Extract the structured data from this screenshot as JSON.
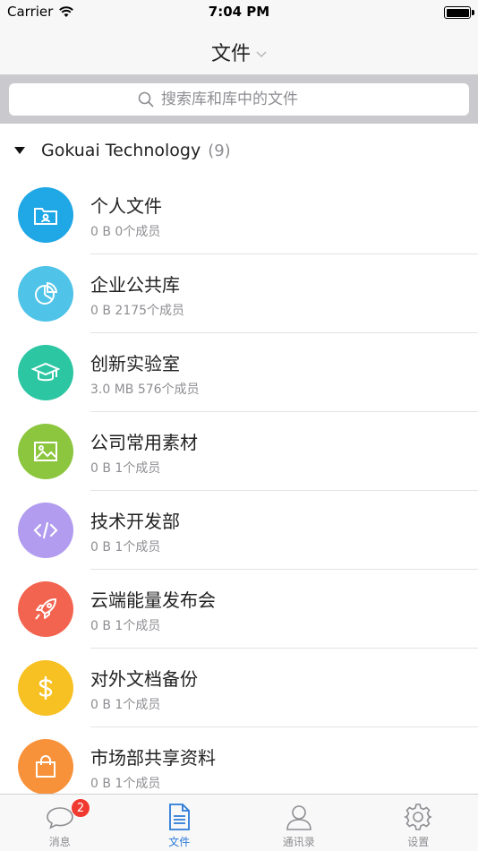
{
  "status": {
    "carrier": "Carrier",
    "time": "7:04 PM"
  },
  "nav": {
    "title": "文件"
  },
  "search": {
    "placeholder": "搜索库和库中的文件"
  },
  "group": {
    "name": "Gokuai Technology",
    "count": "(9)"
  },
  "items": [
    {
      "title": "个人文件",
      "sub": "0 B 0个成员",
      "color": "#1fa7e6",
      "icon": "user-folder-icon"
    },
    {
      "title": "企业公共库",
      "sub": "0 B 2175个成员",
      "color": "#4fc3e8",
      "icon": "pie-chart-icon"
    },
    {
      "title": "创新实验室",
      "sub": "3.0 MB 576个成员",
      "color": "#2cc6a3",
      "icon": "graduation-cap-icon"
    },
    {
      "title": "公司常用素材",
      "sub": "0 B 1个成员",
      "color": "#8cc63f",
      "icon": "image-icon"
    },
    {
      "title": "技术开发部",
      "sub": "0 B 1个成员",
      "color": "#b29cf0",
      "icon": "code-icon"
    },
    {
      "title": "云端能量发布会",
      "sub": "0 B 1个成员",
      "color": "#f26450",
      "icon": "rocket-icon"
    },
    {
      "title": "对外文档备份",
      "sub": "0 B 1个成员",
      "color": "#f7c123",
      "icon": "dollar-icon"
    },
    {
      "title": "市场部共享资料",
      "sub": "0 B 1个成员",
      "color": "#f7923a",
      "icon": "shopping-bag-icon"
    }
  ],
  "tabs": [
    {
      "label": "消息",
      "badge": "2",
      "icon": "chat-bubble-icon"
    },
    {
      "label": "文件",
      "icon": "document-icon",
      "active": true
    },
    {
      "label": "通讯录",
      "icon": "person-icon"
    },
    {
      "label": "设置",
      "icon": "gear-icon"
    }
  ],
  "colors": {
    "accent": "#2a7ad8",
    "badge": "#f03a30"
  }
}
